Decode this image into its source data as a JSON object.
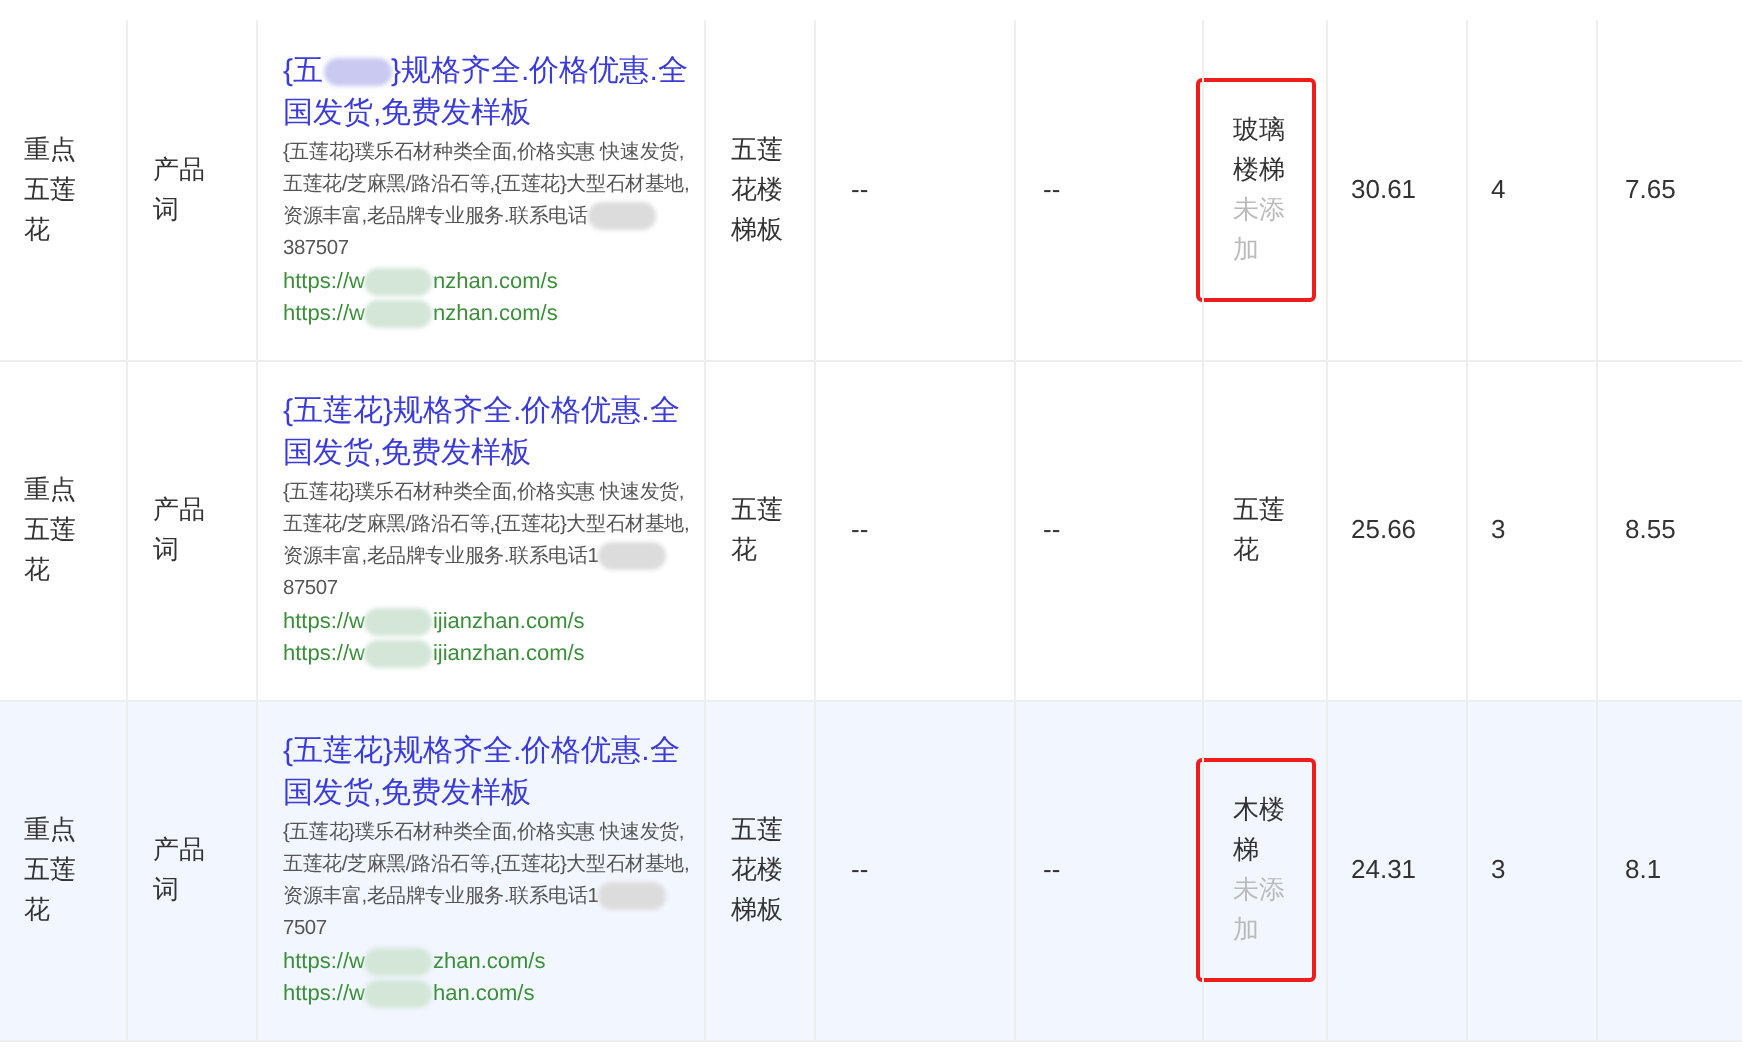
{
  "rows": [
    {
      "selected": false,
      "column_1": "重点五莲花",
      "column_2": "产品词",
      "column_3": {
        "title": [
          "{五",
          "}规格齐全.价格优惠.全国发货,免费发样板"
        ],
        "description": [
          "{五莲花}璞乐石材种类全面,价格实惠 快速发货,五莲花/芝麻黑/路沿石等,{五莲花}大型石材基地,资源丰富,老品牌专业服务.联系电话",
          "387507"
        ],
        "urls": [
          [
            "https://w",
            "nzhan.com/s"
          ],
          [
            "https://w",
            "nzhan.com/s"
          ]
        ]
      },
      "column_4": "五莲花楼梯板",
      "column_5": "--",
      "column_6": "--",
      "column_7": {
        "keyword": "玻璃楼梯",
        "status": "未添加",
        "highlighted": true
      },
      "column_8": "30.61",
      "column_9": "4",
      "column_10": "7.65"
    },
    {
      "selected": false,
      "column_1": "重点五莲花",
      "column_2": "产品词",
      "column_3": {
        "title": [
          "{五莲花}规格齐全.价格优惠.全国发货,免费发样板"
        ],
        "description": [
          "{五莲花}璞乐石材种类全面,价格实惠 快速发货,五莲花/芝麻黑/路沿石等,{五莲花}大型石材基地,资源丰富,老品牌专业服务.联系电话1",
          "87507"
        ],
        "urls": [
          [
            "https://w",
            "ijianzhan.com/s"
          ],
          [
            "https://w",
            "ijianzhan.com/s"
          ]
        ]
      },
      "column_4": "五莲花",
      "column_5": "--",
      "column_6": "--",
      "column_7": {
        "keyword": "五莲花",
        "highlighted": false
      },
      "column_8": "25.66",
      "column_9": "3",
      "column_10": "8.55"
    },
    {
      "selected": true,
      "column_1": "重点五莲花",
      "column_2": "产品词",
      "column_3": {
        "title": [
          "{五莲花}规格齐全.价格优惠.全国发货,免费发样板"
        ],
        "description": [
          "{五莲花}璞乐石材种类全面,价格实惠 快速发货,五莲花/芝麻黑/路沿石等,{五莲花}大型石材基地,资源丰富,老品牌专业服务.联系电话1",
          "7507"
        ],
        "urls": [
          [
            "https://w",
            "zhan.com/s"
          ],
          [
            "https://w",
            "han.com/s"
          ]
        ]
      },
      "column_4": "五莲花楼梯板",
      "column_5": "--",
      "column_6": "--",
      "column_7": {
        "keyword": "木楼梯",
        "status": "未添加",
        "highlighted": true
      },
      "column_8": "24.31",
      "column_9": "3",
      "column_10": "8.1"
    }
  ]
}
